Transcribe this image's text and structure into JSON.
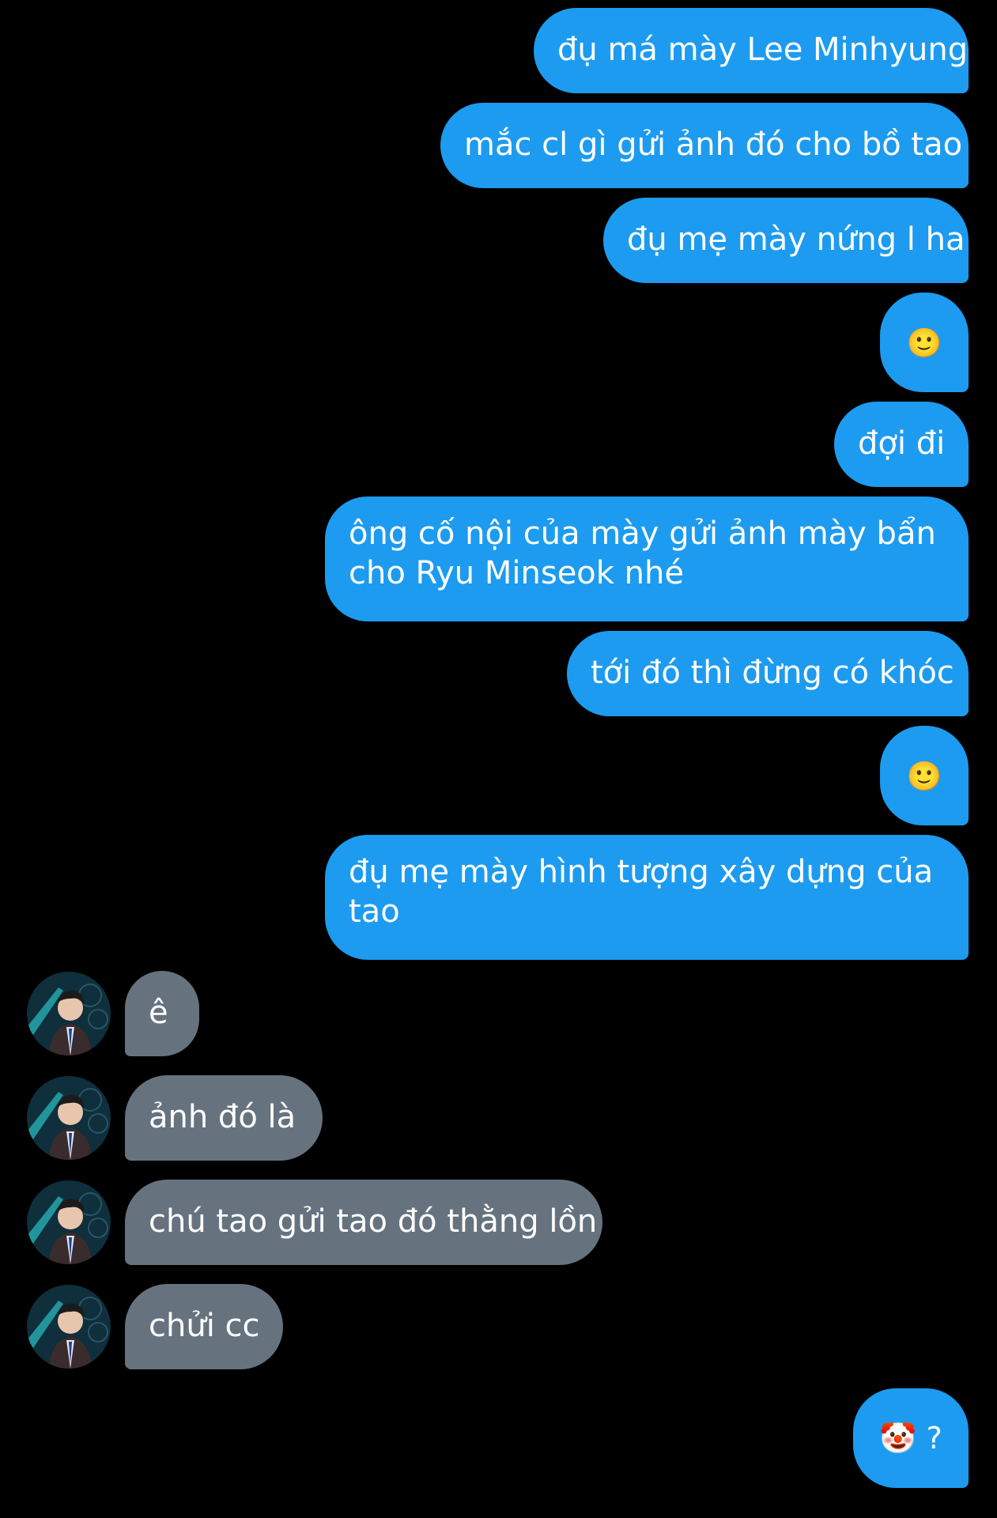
{
  "messages": [
    {
      "side": "out",
      "text": "đụ má mày Lee Minhyung"
    },
    {
      "side": "out",
      "text": "mắc cl gì gửi ảnh đó cho bồ tao"
    },
    {
      "side": "out",
      "text": "đụ mẹ mày nứng l ha"
    },
    {
      "side": "out",
      "emoji": "🙂"
    },
    {
      "side": "out",
      "text": "đợi đi"
    },
    {
      "side": "out",
      "text": "ông cố nội của mày gửi ảnh mày bẩn cho Ryu Minseok nhé"
    },
    {
      "side": "out",
      "text": "tới đó thì đừng có khóc"
    },
    {
      "side": "out",
      "emoji": "🙂"
    },
    {
      "side": "out",
      "text": "đụ mẹ mày hình tượng xây dựng của tao"
    },
    {
      "side": "in",
      "text": "ê"
    },
    {
      "side": "in",
      "text": "ảnh đó là"
    },
    {
      "side": "in",
      "text": "chú tao gửi tao đó thằng lồn"
    },
    {
      "side": "in",
      "text": "chửi cc"
    },
    {
      "side": "out",
      "text": "🤡 ?"
    }
  ],
  "colors": {
    "background": "#000000",
    "outgoing_bubble": "#1d9bf0",
    "incoming_bubble": "#66737f",
    "text": "#ffffff"
  }
}
